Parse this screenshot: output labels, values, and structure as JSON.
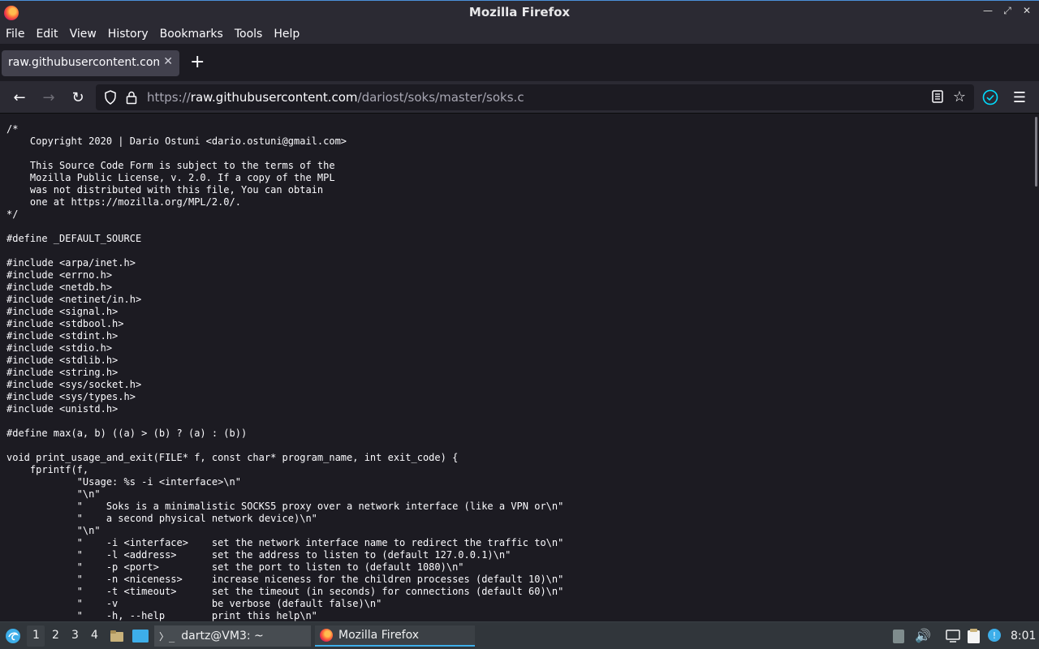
{
  "window": {
    "title": "Mozilla Firefox"
  },
  "menubar": [
    "File",
    "Edit",
    "View",
    "History",
    "Bookmarks",
    "Tools",
    "Help"
  ],
  "tab": {
    "title": "raw.githubusercontent.com/dariost/soks/master/soks.c"
  },
  "urlbar": {
    "scheme": "https://",
    "host": "raw.githubusercontent.com",
    "path": "/dariost/soks/master/soks.c"
  },
  "content": {
    "lines": [
      "/*",
      "    Copyright 2020 | Dario Ostuni <dario.ostuni@gmail.com>",
      "",
      "    This Source Code Form is subject to the terms of the",
      "    Mozilla Public License, v. 2.0. If a copy of the MPL",
      "    was not distributed with this file, You can obtain",
      "    one at https://mozilla.org/MPL/2.0/.",
      "*/",
      "",
      "#define _DEFAULT_SOURCE",
      "",
      "#include <arpa/inet.h>",
      "#include <errno.h>",
      "#include <netdb.h>",
      "#include <netinet/in.h>",
      "#include <signal.h>",
      "#include <stdbool.h>",
      "#include <stdint.h>",
      "#include <stdio.h>",
      "#include <stdlib.h>",
      "#include <string.h>",
      "#include <sys/socket.h>",
      "#include <sys/types.h>",
      "#include <unistd.h>",
      "",
      "#define max(a, b) ((a) > (b) ? (a) : (b))",
      "",
      "void print_usage_and_exit(FILE* f, const char* program_name, int exit_code) {",
      "    fprintf(f,",
      "            \"Usage: %s -i <interface>\\n\"",
      "            \"\\n\"",
      "            \"    Soks is a minimalistic SOCKS5 proxy over a network interface (like a VPN or\\n\"",
      "            \"    a second physical network device)\\n\"",
      "            \"\\n\"",
      "            \"    -i <interface>    set the network interface name to redirect the traffic to\\n\"",
      "            \"    -l <address>      set the address to listen to (default 127.0.0.1)\\n\"",
      "            \"    -p <port>         set the port to listen to (default 1080)\\n\"",
      "            \"    -n <niceness>     increase niceness for the children processes (default 10)\\n\"",
      "            \"    -t <timeout>      set the timeout (in seconds) for connections (default 60)\\n\"",
      "            \"    -v                be verbose (default false)\\n\"",
      "            \"    -h, --help        print this help\\n\""
    ]
  },
  "taskbar": {
    "workspaces": [
      "1",
      "2",
      "3",
      "4"
    ],
    "tasks": [
      "dartz@VM3: ~",
      "Mozilla Firefox"
    ],
    "clock": "8:01"
  }
}
